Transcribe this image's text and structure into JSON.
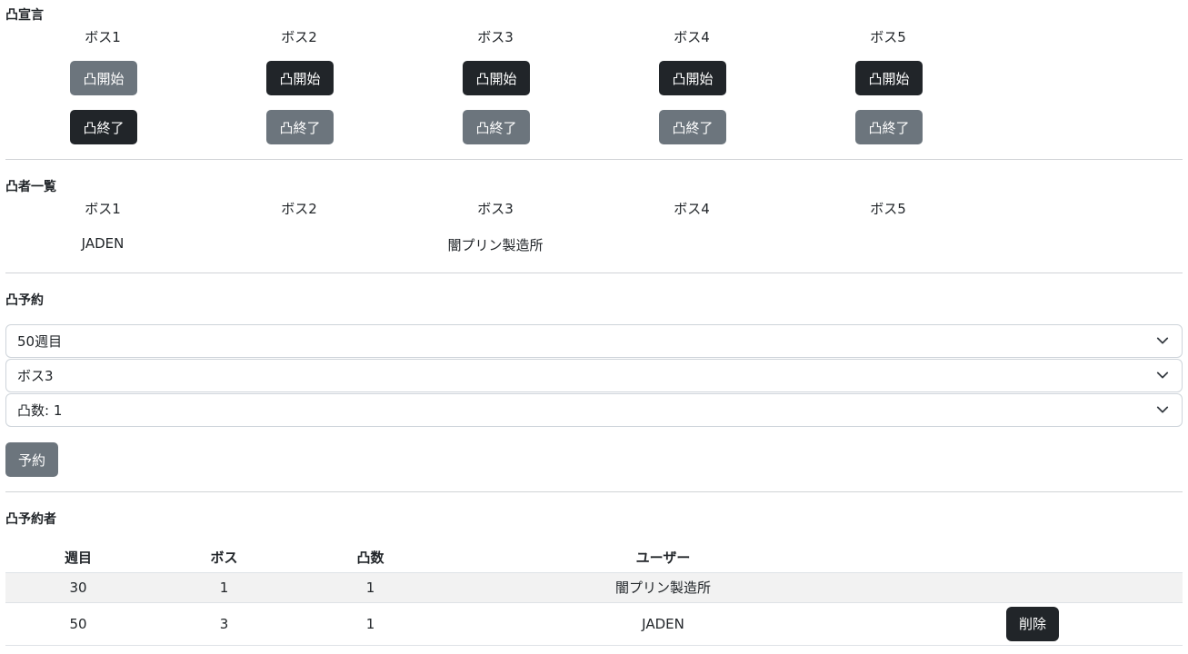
{
  "declare": {
    "title": "凸宣言",
    "bosses": [
      "ボス1",
      "ボス2",
      "ボス3",
      "ボス4",
      "ボス5"
    ],
    "start_label": "凸開始",
    "end_label": "凸終了"
  },
  "attackers": {
    "title": "凸者一覧",
    "bosses": [
      "ボス1",
      "ボス2",
      "ボス3",
      "ボス4",
      "ボス5"
    ],
    "names": [
      "JADEN",
      "",
      "闇プリン製造所",
      "",
      ""
    ]
  },
  "reserve": {
    "title": "凸予約",
    "week_select": "50週目",
    "boss_select": "ボス3",
    "count_select": "凸数: 1",
    "submit_label": "予約"
  },
  "reservers": {
    "title": "凸予約者",
    "columns": [
      "週目",
      "ボス",
      "凸数",
      "ユーザー"
    ],
    "rows": [
      {
        "week": "30",
        "boss": "1",
        "count": "1",
        "user": "闇プリン製造所",
        "delete": ""
      },
      {
        "week": "50",
        "boss": "3",
        "count": "1",
        "user": "JADEN",
        "delete": "削除"
      }
    ]
  },
  "colors": {
    "dark_button": "#212529",
    "gray_button": "#6c757d"
  }
}
